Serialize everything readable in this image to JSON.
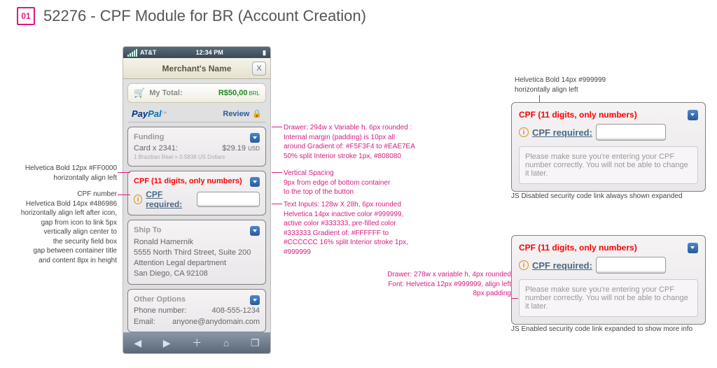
{
  "page": {
    "badge": "01",
    "title": "52276 - CPF Module for BR (Account Creation)"
  },
  "phone": {
    "carrier": "AT&T",
    "time": "12:34 PM",
    "merchant": "Merchant's Name",
    "close": "X",
    "mytotal_label": "My Total:",
    "total_amount": "R$50,00",
    "total_currency": "BRL",
    "paypal1": "Pay",
    "paypal2": "Pal",
    "tm": "™",
    "review": "Review",
    "funding": {
      "hd": "Funding",
      "card": "Card x 2341:",
      "amount": "$29.19",
      "cur": "USD",
      "rate": "1 Brazilian Real = 0.5838 US Dollars"
    },
    "cpf": {
      "error": "CPF (11 digits, only numbers)",
      "link": "CPF required:",
      "info": "i"
    },
    "shipto": {
      "hd": "Ship To",
      "l1": "Ronald Hamernik",
      "l2": "5555 North Third Street, Suite 200",
      "l3": "Attention Legal department",
      "l4": "San Diego, CA 92108"
    },
    "other": {
      "hd": "Other Options",
      "phone_l": "Phone number:",
      "phone_v": "408-555-1234",
      "email_l": "Email:",
      "email_v": "anyone@anydomain.com"
    },
    "toolbar": {
      "back": "◀",
      "fwd": "▶",
      "plus": "＋",
      "book": "⌂",
      "tabs": "❐"
    }
  },
  "annos": {
    "left1": "Helvetica Bold 12px #FF0000\nhorizontally align left",
    "left2": "CPF number\nHelvetica Bold 14px #486986\nhorizontally align left after icon,\ngap from icon to link 5px\nvertically align center to\nthe security field box\ngap between container title\nand content 8px in height",
    "mid1": "Drawer: 294w x Variable h, 6px rounded :\nInternal margin (padding) is 10px all\naround Gradient of: #F5F3F4 to #EAE7EA\n50% split Interior stroke 1px, #808080",
    "mid2": "Vertical Spacing\n9px from edge of bottom container\nto the top of the button",
    "mid3": "Text Inputs: 128w X 28h, 6px rounded\nHelvetica 14px inactive color #999999,\nactive color #333333, pre-filled color\n#333333 Gradient of: #FFFFFF to\n#CCCCCC 16% split Interior stroke 1px,\n#999999",
    "right_hd": "Helvetica Bold 14px #999999\nhorizontally align left",
    "r_cap1": "JS Disabled security code link always shown expanded",
    "r_mid": "Drawer: 278w x variable h, 4px rounded\nFont: Helvetica 12px #999999, align left\n8px padding",
    "r_cap2": "JS Enabled security code link expanded to show more info"
  },
  "drawer": {
    "error": "CPF (11 digits, only numbers)",
    "link": "CPF required:",
    "info": "i",
    "msg": "Please make sure you're entering your CPF number correctly. You will not be able to change it later."
  }
}
